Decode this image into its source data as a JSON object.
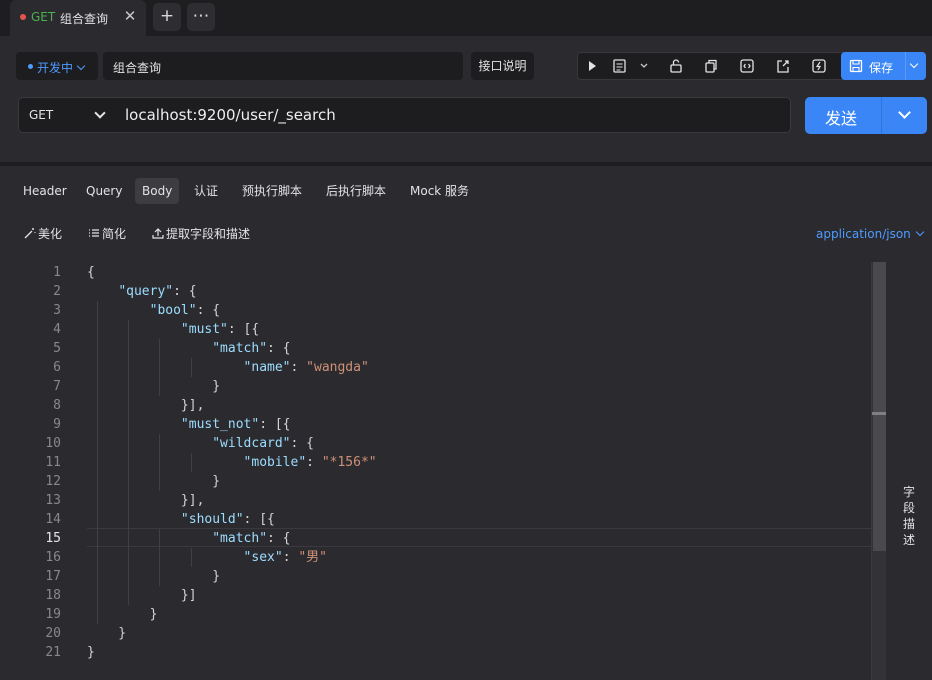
{
  "tabs": {
    "active": {
      "method": "GET",
      "title": "组合查询",
      "close": "✕"
    },
    "new_tab": "+",
    "more": "⋯"
  },
  "request": {
    "status": "开发中",
    "name": "组合查询",
    "doc_button": "接口说明",
    "save_label": "保存",
    "method": "GET",
    "url": "localhost:9200/user/_search",
    "send_label": "发送"
  },
  "toolbar_icons": [
    "play-icon",
    "doc-icon",
    "chevron-down-icon",
    "unlock-icon",
    "copy-icon",
    "code-icon",
    "share-icon",
    "flash-icon"
  ],
  "req_tabs": [
    "Header",
    "Query",
    "Body",
    "认证",
    "预执行脚本",
    "后执行脚本",
    "Mock 服务"
  ],
  "active_req_tab": "Body",
  "body_tools": {
    "beautify": "美化",
    "simplify": "简化",
    "extract": "提取字段和描述",
    "content_type": "application/json"
  },
  "editor": {
    "current_line": 15,
    "lines": [
      "{",
      "    \"query\": {",
      "        \"bool\": {",
      "            \"must\": [{",
      "                \"match\": {",
      "                    \"name\": \"wangda\"",
      "                }",
      "            }],",
      "            \"must_not\": [{",
      "                \"wildcard\": {",
      "                    \"mobile\": \"*156*\"",
      "                }",
      "            }],",
      "            \"should\": [{",
      "                \"match\": {",
      "                    \"sex\": \"男\"",
      "                }",
      "            }]",
      "        }",
      "    }",
      "}"
    ]
  },
  "side_panel": {
    "label": "字段描述"
  },
  "colors": {
    "accent": "#3b86f6",
    "key": "#9cdcfe",
    "string": "#ce9178",
    "get_method": "#4caf50",
    "status_dot": "#e5554f"
  }
}
